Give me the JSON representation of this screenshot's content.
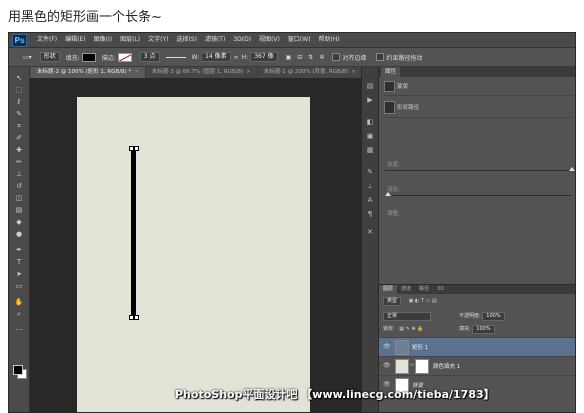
{
  "caption": "用黑色的矩形画一个长条~",
  "app": {
    "logo": "Ps",
    "menu": [
      "文件(F)",
      "编辑(E)",
      "图像(I)",
      "图层(L)",
      "文字(Y)",
      "选择(S)",
      "滤镜(T)",
      "3D(D)",
      "视图(V)",
      "窗口(W)",
      "帮助(H)"
    ]
  },
  "options": {
    "tool_dropdown": "形状",
    "fill_label": "填充:",
    "stroke_label": "描边:",
    "stroke_width": "3 点",
    "w_label": "W:",
    "w_value": "14 像素",
    "h_label": "H:",
    "h_value": "367 像",
    "align_edges": "对齐边缘",
    "constrain_path": "约束路径拖动"
  },
  "tabs": [
    {
      "label": "未标题-2 @ 100% (矩形 1, RGB/8) *"
    },
    {
      "label": "未标题-3 @ 66.7% (图层 1, RGB/8)"
    },
    {
      "label": "未标题-1 @ 200% (背景, RGB/8)"
    }
  ],
  "properties": {
    "panel_tab": "属性",
    "mask_label": "蒙版",
    "shape_label": "形状路径",
    "density_label": "浓度:",
    "feather_label": "羽化:",
    "adjust_label": "调整:"
  },
  "layers": {
    "tabs": [
      "图层",
      "通道",
      "路径",
      "3D"
    ],
    "kind_label": "类型",
    "blend_mode": "正常",
    "opacity_label": "不透明度:",
    "opacity_value": "100%",
    "lock_label": "锁定:",
    "fill_label": "填充:",
    "fill_value": "100%",
    "items": [
      {
        "name": "矩形 1"
      },
      {
        "name": "颜色填充 1"
      },
      {
        "name": "背景"
      }
    ]
  },
  "watermark": "PhotoShop平面设计吧 【www.linecg.com/tieba/1783】",
  "colors": {
    "canvas": "#e1e3d7",
    "rectangle": "#000000",
    "workspace": "#282828",
    "selected_layer": "#5c738f"
  }
}
